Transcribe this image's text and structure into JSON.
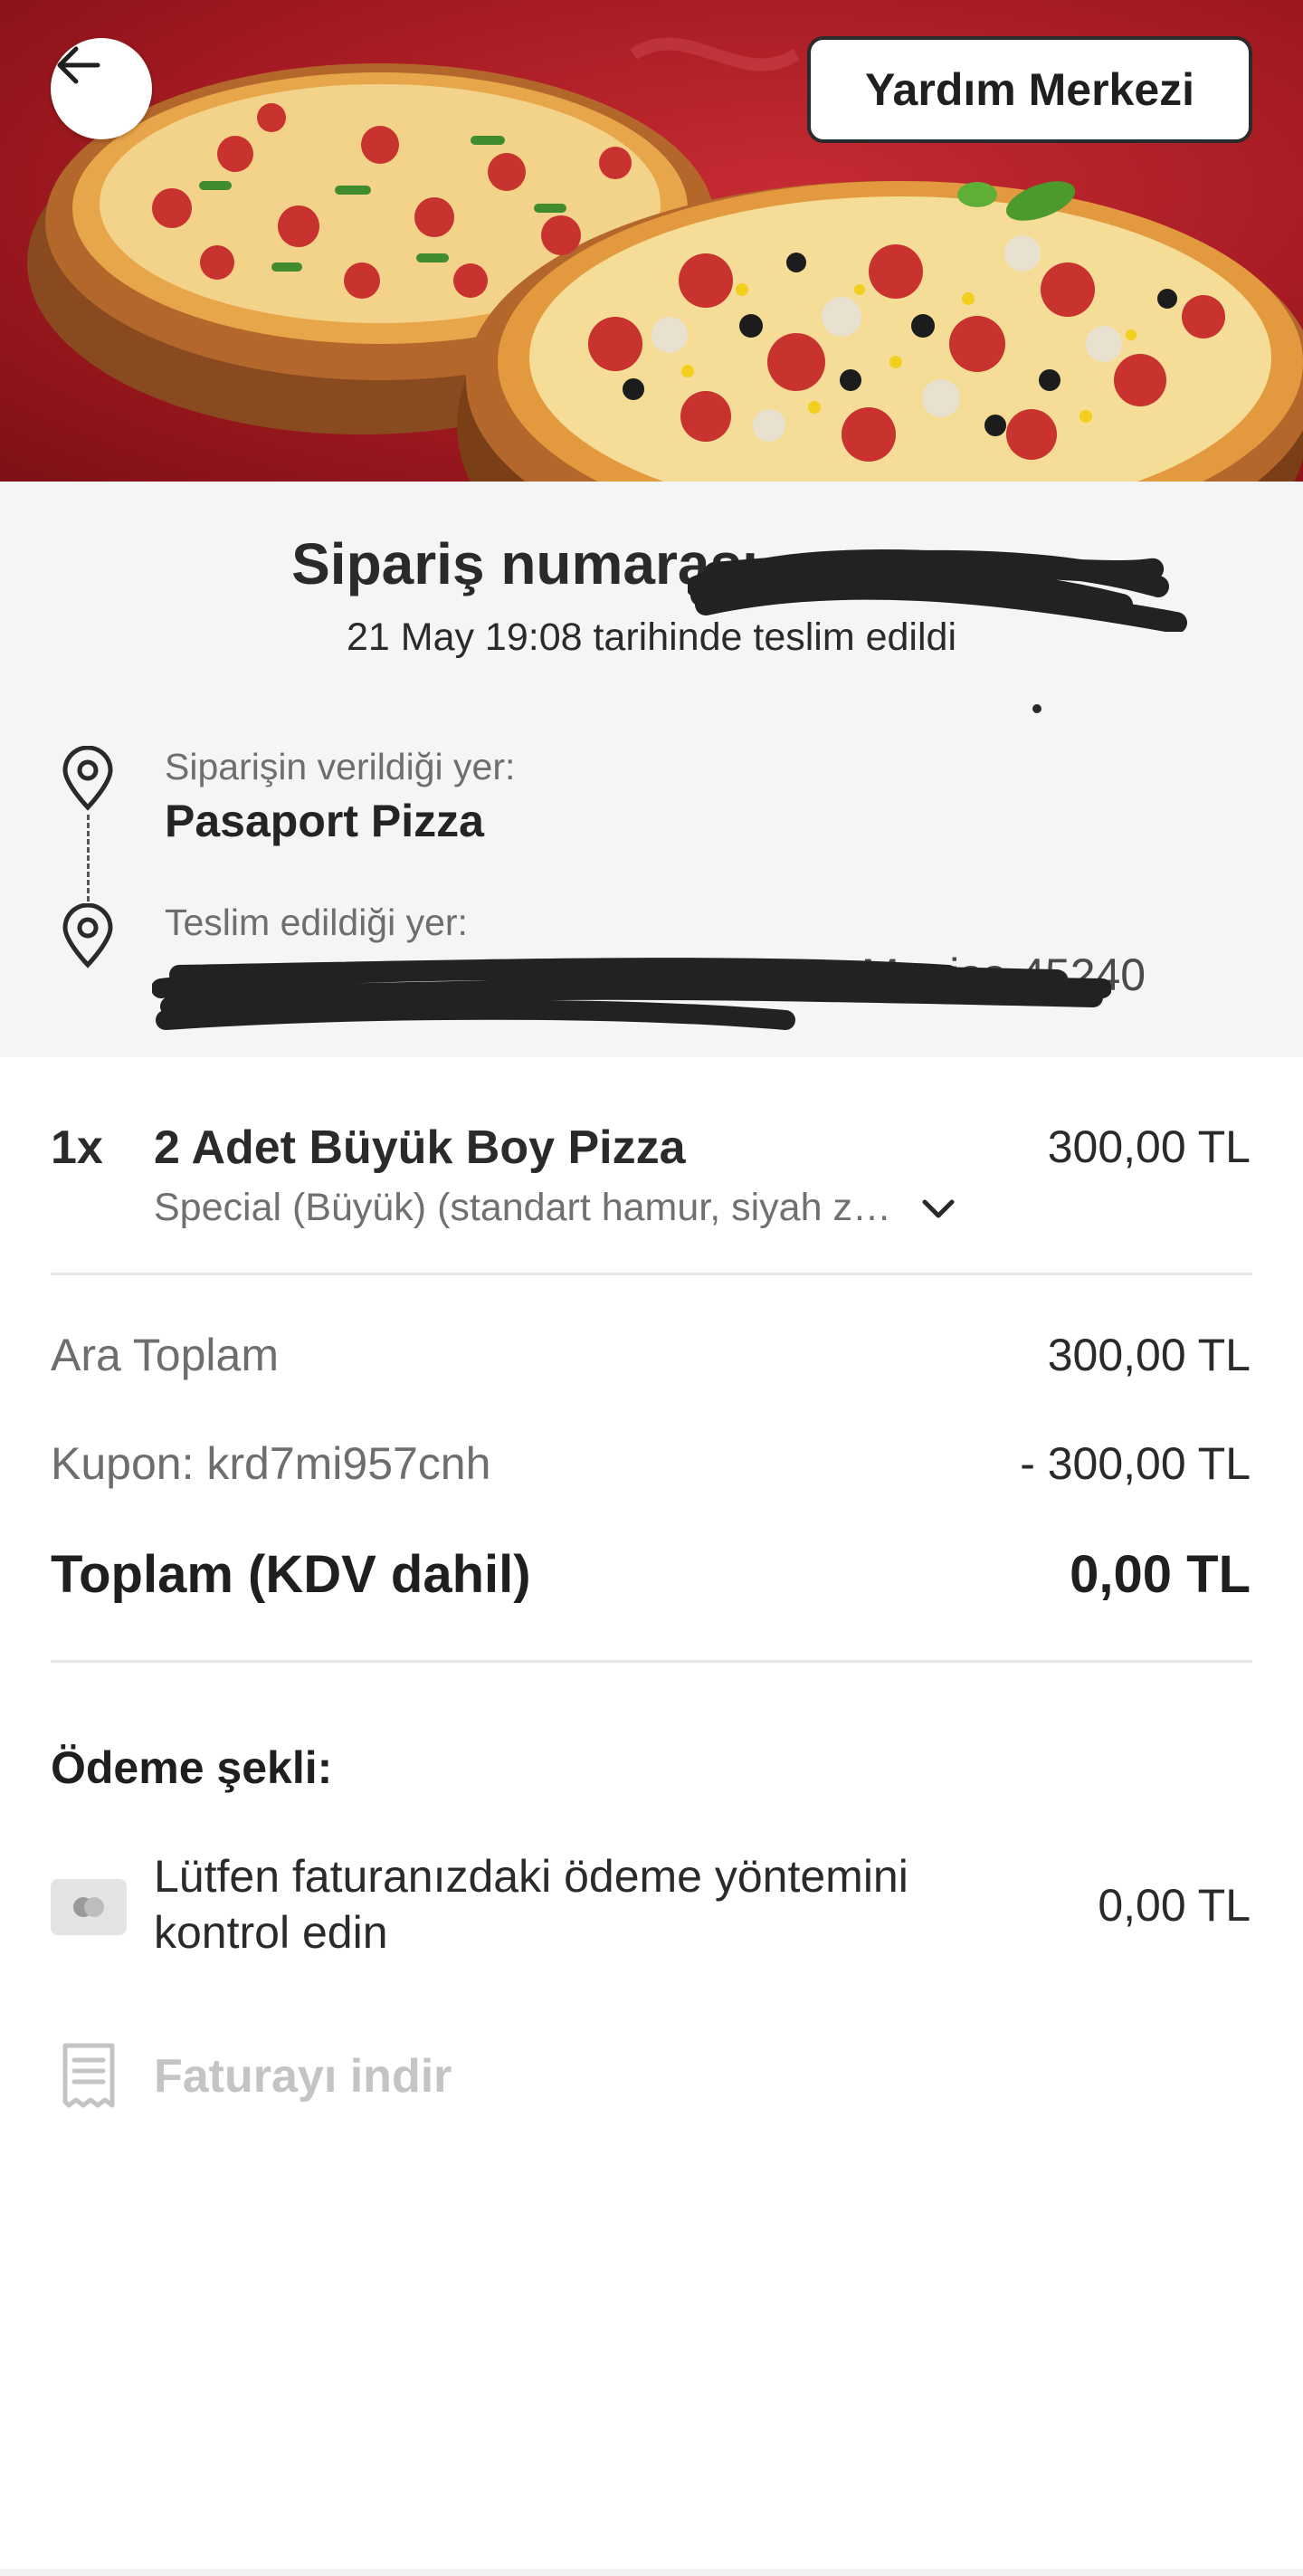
{
  "header": {
    "help_button_label": "Yardım Merkezi"
  },
  "order": {
    "title": "Sipariş numarası",
    "delivered_text": "21 May 19:08 tarihinde teslim edildi",
    "restaurant_label": "Siparişin verildiği yer:",
    "restaurant_name": "Pasaport Pizza",
    "delivery_label": "Teslim edildiği yer:",
    "delivery_address": "Manisa 45240"
  },
  "item": {
    "quantity": "1x",
    "name": "2 Adet Büyük Boy Pizza",
    "price": "300,00 TL",
    "description": "Special (Büyük) (standart hamur, siyah zeytin, mantar, mısır)"
  },
  "totals": {
    "subtotal_label": "Ara Toplam",
    "subtotal_value": "300,00 TL",
    "coupon_label": "Kupon: krd7mi957cnh",
    "coupon_value": "- 300,00 TL",
    "total_label": "Toplam (KDV dahil)",
    "total_value": "0,00 TL"
  },
  "payment": {
    "title": "Ödeme şekli:",
    "method_text": "Lütfen faturanızdaki ödeme yöntemini kontrol edin",
    "amount": "0,00 TL"
  },
  "invoice": {
    "download_label": "Faturayı indir"
  },
  "colors": {
    "hero_red": "#a51a22",
    "info_bg": "#f5f5f5",
    "disabled_text": "#c4c4c4"
  },
  "icons": [
    "arrow-left-icon",
    "map-pin-icon",
    "chevron-down-icon",
    "card-icon",
    "receipt-icon"
  ]
}
